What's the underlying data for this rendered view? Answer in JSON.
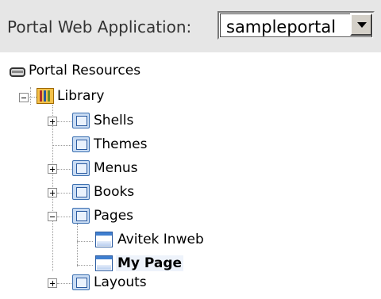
{
  "header": {
    "label": "Portal Web Application:",
    "dropdown_value": "sampleportal"
  },
  "tree": {
    "root": "Portal Resources",
    "library": "Library",
    "items": {
      "shells": "Shells",
      "themes": "Themes",
      "menus": "Menus",
      "books": "Books",
      "pages": "Pages",
      "avitek_inweb": "Avitek Inweb",
      "my_page": "My Page",
      "layouts": "Layouts"
    }
  }
}
